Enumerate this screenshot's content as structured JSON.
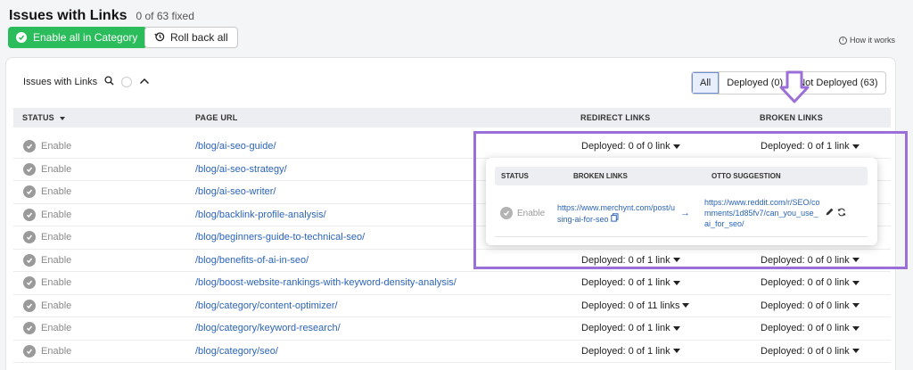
{
  "header": {
    "title": "Issues with Links",
    "fixed_count": "0 of 63 fixed",
    "enable_all_label": "Enable all in Category",
    "rollback_label": "Roll back all",
    "how_it_works": "How it works"
  },
  "card": {
    "title": "Issues with Links",
    "filters": {
      "all": "All",
      "deployed": "Deployed (0)",
      "not_deployed": "Not Deployed (63)"
    }
  },
  "table": {
    "columns": {
      "status": "STATUS",
      "page_url": "PAGE URL",
      "redirect": "REDIRECT LINKS",
      "broken": "BROKEN LINKS"
    },
    "rows": [
      {
        "status": "Enable",
        "url": "/blog/ai-seo-guide/",
        "redirect": "Deployed: 0 of 0 link",
        "broken": "Deployed: 0 of 1 link"
      },
      {
        "status": "Enable",
        "url": "/blog/ai-seo-strategy/",
        "redirect": "",
        "broken": ""
      },
      {
        "status": "Enable",
        "url": "/blog/ai-seo-writer/",
        "redirect": "",
        "broken": ""
      },
      {
        "status": "Enable",
        "url": "/blog/backlink-profile-analysis/",
        "redirect": "",
        "broken": ""
      },
      {
        "status": "Enable",
        "url": "/blog/beginners-guide-to-technical-seo/",
        "redirect": "",
        "broken": ""
      },
      {
        "status": "Enable",
        "url": "/blog/benefits-of-ai-in-seo/",
        "redirect": "Deployed: 0 of 1 link",
        "broken": "Deployed: 0 of 0 link"
      },
      {
        "status": "Enable",
        "url": "/blog/boost-website-rankings-with-keyword-density-analysis/",
        "redirect": "Deployed: 0 of 1 link",
        "broken": "Deployed: 0 of 0 link"
      },
      {
        "status": "Enable",
        "url": "/blog/category/content-optimizer/",
        "redirect": "Deployed: 0 of 11 links",
        "broken": "Deployed: 0 of 0 link"
      },
      {
        "status": "Enable",
        "url": "/blog/category/keyword-research/",
        "redirect": "Deployed: 0 of 1 link",
        "broken": "Deployed: 0 of 0 link"
      },
      {
        "status": "Enable",
        "url": "/blog/category/seo/",
        "redirect": "Deployed: 0 of 1 link",
        "broken": "Deployed: 0 of 0 link"
      }
    ]
  },
  "popup": {
    "columns": {
      "status": "STATUS",
      "broken": "BROKEN LINKS",
      "suggestion": "OTTO SUGGESTION"
    },
    "status": "Enable",
    "broken_link": "https://www.merchynt.com/post/using-ai-for-seo",
    "arrow": "→",
    "suggestion_link": "https://www.reddit.com/r/SEO/comments/1d85fv7/can_you_use_ai_for_seo/"
  },
  "colors": {
    "green": "#2bbd5b",
    "link": "#2b63b8",
    "highlight": "#9b6fd8"
  }
}
